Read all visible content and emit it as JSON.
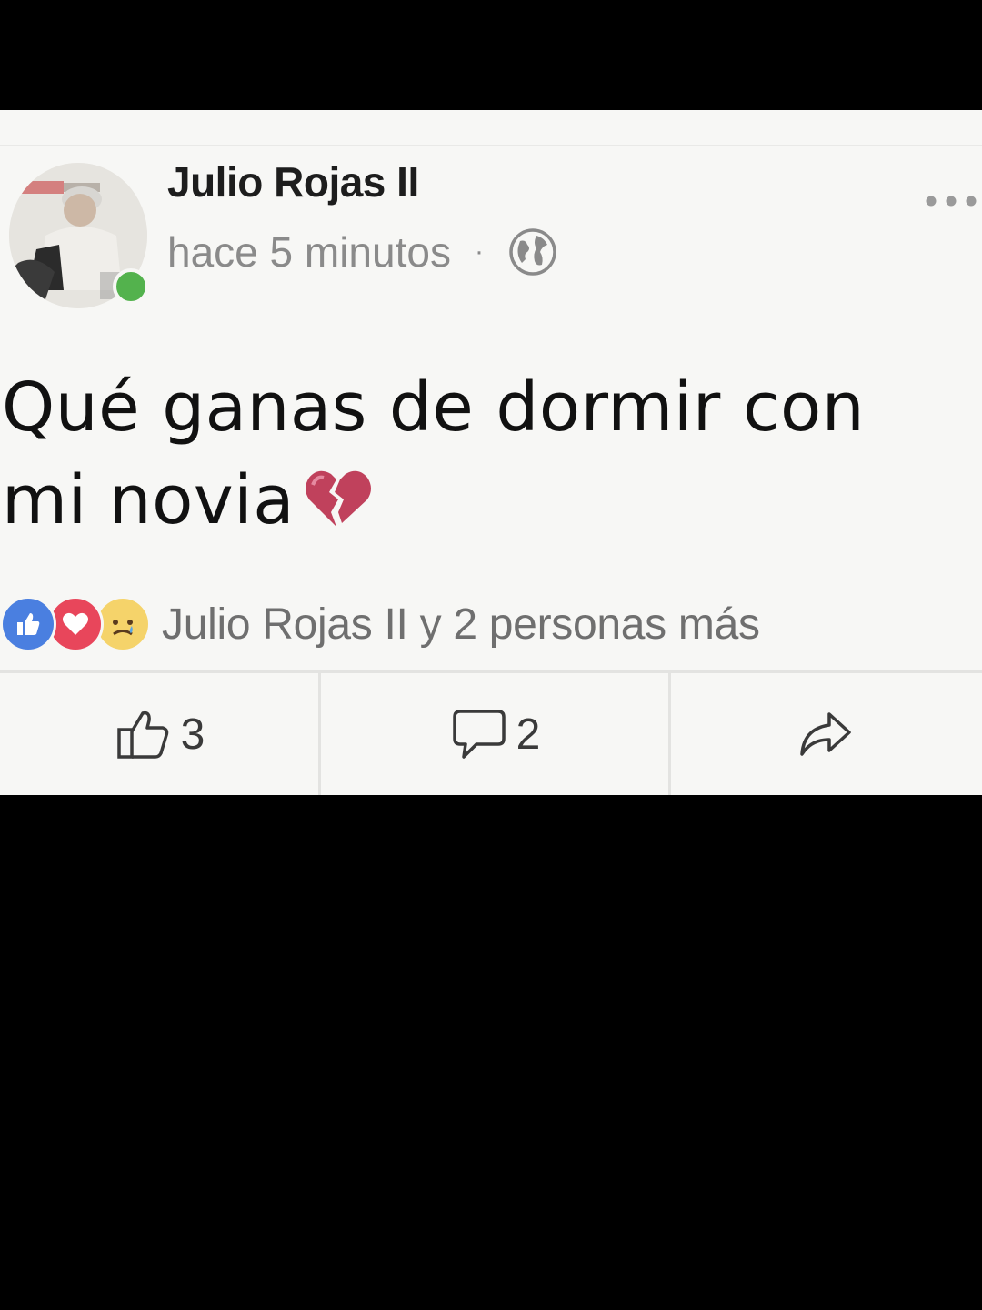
{
  "post": {
    "author": "Julio Rojas II",
    "timestamp": "hace 5 minutos",
    "separator": "·",
    "privacy_icon": "globe-icon",
    "online_status_color": "#53b24d",
    "text": "Qué ganas de dormir con mi novia",
    "text_emoji": "broken-heart-icon"
  },
  "reactions": {
    "icons": [
      "like-reaction-icon",
      "love-reaction-icon",
      "sad-reaction-icon"
    ],
    "summary": "Julio Rojas II y 2 personas más"
  },
  "actions": {
    "like_count": "3",
    "comment_count": "2",
    "share_icon": "share-icon"
  },
  "colors": {
    "like_blue": "#4a7fe0",
    "love_red": "#e8465b",
    "sad_yellow": "#f5d36a",
    "broken_heart": "#c0415c"
  }
}
